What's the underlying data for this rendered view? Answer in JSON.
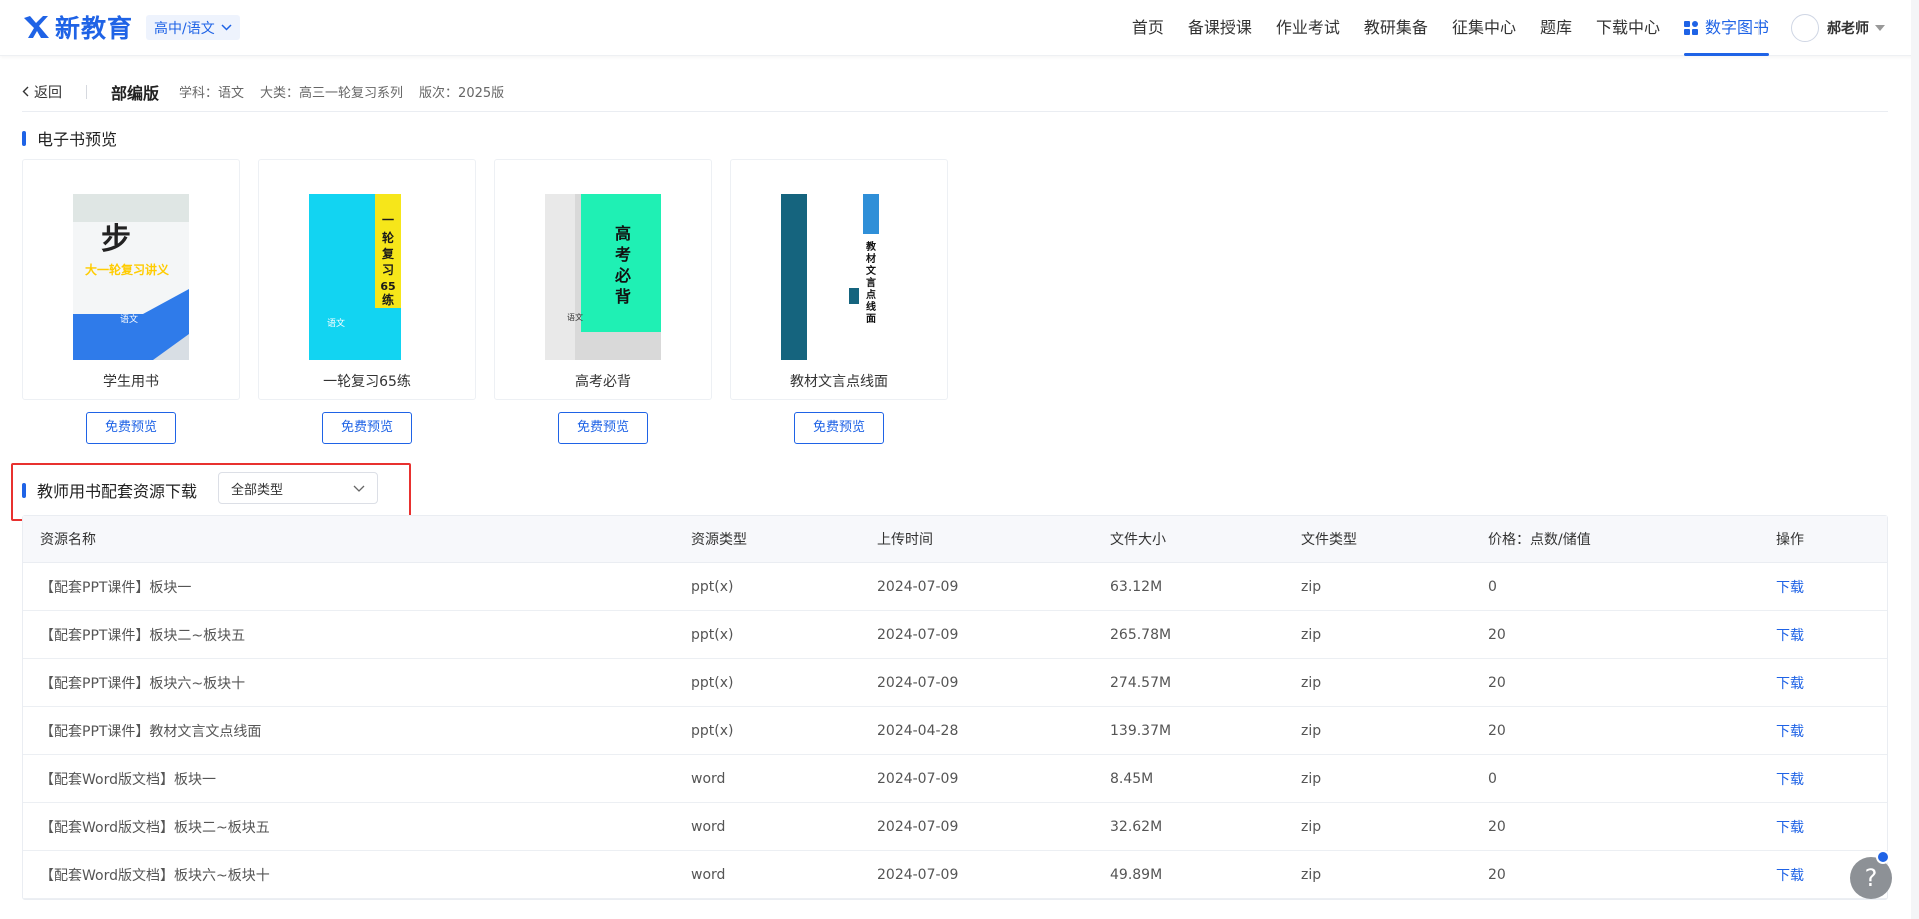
{
  "header": {
    "logo_text": "新教育",
    "grade_subject": "高中/语文",
    "nav": [
      "首页",
      "备课授课",
      "作业考试",
      "教研集备",
      "征集中心",
      "题库",
      "下载中心"
    ],
    "nav_active": "数字图书",
    "user_name": "郝老师"
  },
  "breadcrumb": {
    "back": "返回",
    "edition": "部编版",
    "subject": "学科：语文",
    "category": "大类：高三一轮复习系列",
    "version": "版次：2025版"
  },
  "ebooks": {
    "title": "电子书预览",
    "items": [
      {
        "name": "学生用书",
        "cover_text": "大一轮复习讲义",
        "button": "免费预览"
      },
      {
        "name": "一轮复习65练",
        "cover_text": "一轮复习65练",
        "button": "免费预览"
      },
      {
        "name": "高考必背",
        "cover_text": "高考必背",
        "button": "免费预览"
      },
      {
        "name": "教材文言点线面",
        "cover_text": "教材文言点线面",
        "button": "免费预览"
      }
    ]
  },
  "resources": {
    "title": "教师用书配套资源下载",
    "filter_value": "全部类型",
    "columns": [
      "资源名称",
      "资源类型",
      "上传时间",
      "文件大小",
      "文件类型",
      "价格：点数/储值",
      "操作"
    ],
    "rows": [
      [
        "【配套PPT课件】板块一",
        "ppt(x)",
        "2024-07-09",
        "63.12M",
        "zip",
        "0",
        "下载"
      ],
      [
        "【配套PPT课件】板块二~板块五",
        "ppt(x)",
        "2024-07-09",
        "265.78M",
        "zip",
        "20",
        "下载"
      ],
      [
        "【配套PPT课件】板块六~板块十",
        "ppt(x)",
        "2024-07-09",
        "274.57M",
        "zip",
        "20",
        "下载"
      ],
      [
        "【配套PPT课件】教材文言文点线面",
        "ppt(x)",
        "2024-04-28",
        "139.37M",
        "zip",
        "20",
        "下载"
      ],
      [
        "【配套Word版文档】板块一",
        "word",
        "2024-07-09",
        "8.45M",
        "zip",
        "0",
        "下载"
      ],
      [
        "【配套Word版文档】板块二~板块五",
        "word",
        "2024-07-09",
        "32.62M",
        "zip",
        "20",
        "下载"
      ],
      [
        "【配套Word版文档】板块六~板块十",
        "word",
        "2024-07-09",
        "49.89M",
        "zip",
        "20",
        "下载"
      ]
    ]
  },
  "help_label": "?",
  "colors": {
    "accent": "#1f63e6",
    "highlight": "#e8312f"
  }
}
